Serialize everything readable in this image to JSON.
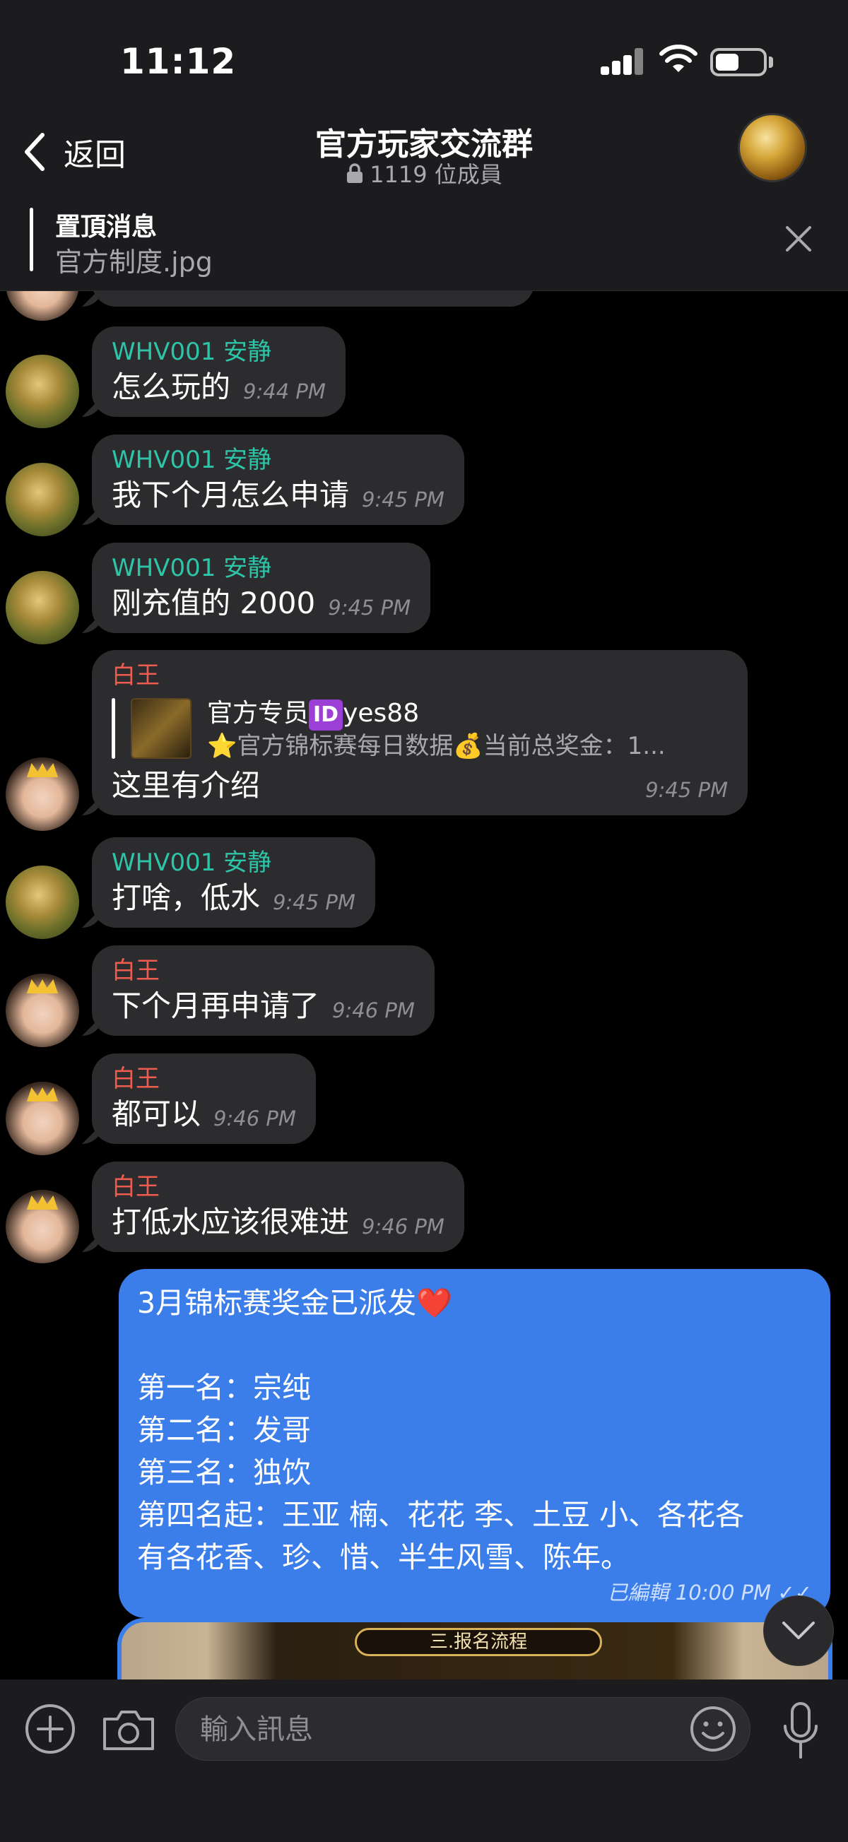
{
  "status_bar": {
    "time": "11:12"
  },
  "header": {
    "back_label": "返回",
    "title": "官方玩家交流群",
    "members": "1119 位成員"
  },
  "pinned": {
    "title": "置頂消息",
    "subtitle": "官方制度.jpg"
  },
  "messages": [
    {
      "sender": "WHV001 安静",
      "text": "怎么玩的",
      "time": "9:44 PM"
    },
    {
      "sender": "WHV001 安静",
      "text": "我下个月怎么申请",
      "time": "9:45 PM"
    },
    {
      "sender": "WHV001 安静",
      "text": "刚充值的 2000",
      "time": "9:45 PM"
    },
    {
      "sender": "白王",
      "reply_author": "官方专员",
      "reply_id_badge": "ID",
      "reply_author_suffix": "yes88",
      "reply_snippet": "⭐官方锦标赛每日数据💰当前总奖金：1...",
      "text": "这里有介绍",
      "time": "9:45 PM"
    },
    {
      "sender": "WHV001 安静",
      "text": "打啥，低水",
      "time": "9:45 PM"
    },
    {
      "sender": "白王",
      "text": "下个月再申请了",
      "time": "9:46 PM"
    },
    {
      "sender": "白王",
      "text": "都可以",
      "time": "9:46 PM"
    },
    {
      "sender": "白王",
      "text": "打低水应该很难进",
      "time": "9:46 PM"
    }
  ],
  "outgoing": {
    "line1": "3月锦标赛奖金已派发",
    "heart": "❤️",
    "body": "第一名：宗纯\n第二名：发哥\n第三名：独饮\n第四名起：王亚 楠、花花 李、土豆 小、各花各\n有各花香、珍、惜、半生风雪、陈年。",
    "edited": "已編輯",
    "time": "10:00 PM",
    "ticks": "✓✓"
  },
  "image_preview": {
    "banner": "三.报名流程"
  },
  "input": {
    "placeholder": "輸入訊息"
  },
  "colors": {
    "accent_blue": "#3b7eea",
    "teal_sender": "#2ec4a8",
    "red_sender": "#ee5b4f"
  }
}
